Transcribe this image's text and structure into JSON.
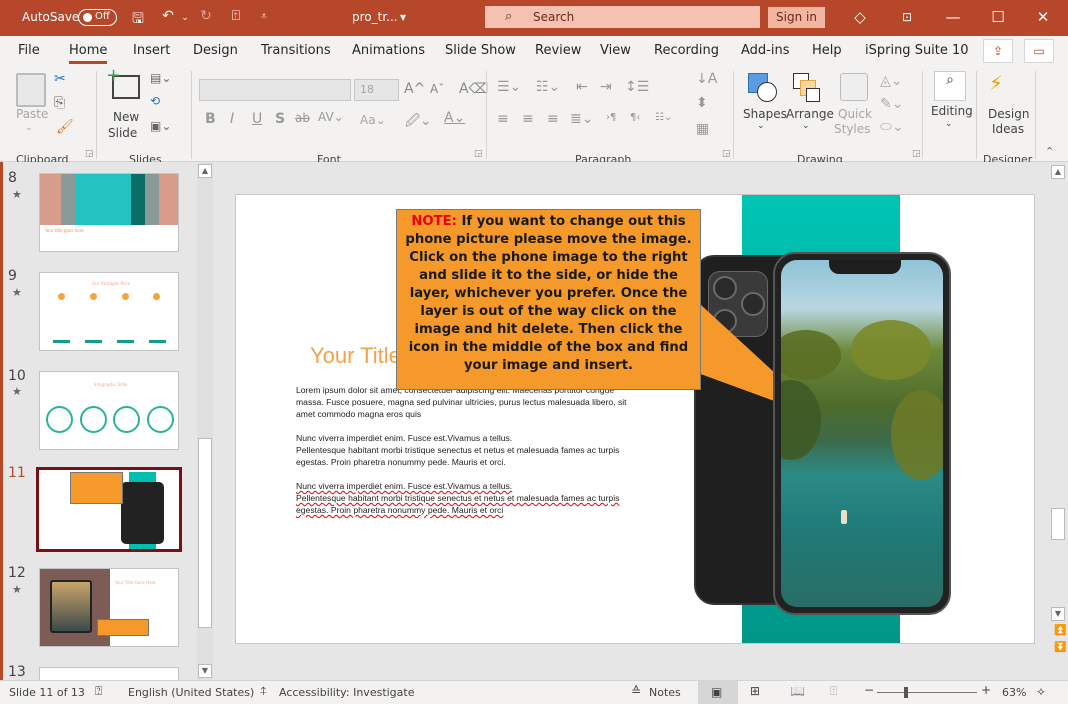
{
  "titlebar": {
    "autosave_label": "AutoSave",
    "autosave_state": "Off",
    "filename": "pro_tr...",
    "search_placeholder": "Search",
    "signin_label": "Sign in",
    "icons": [
      "save-icon",
      "undo-icon",
      "redo-icon",
      "present-icon",
      "customize-icon",
      "diamond-icon",
      "ribbon-display-icon",
      "minimize-icon",
      "maximize-icon",
      "close-icon"
    ]
  },
  "menu": {
    "tabs": [
      "File",
      "Home",
      "Insert",
      "Design",
      "Transitions",
      "Animations",
      "Slide Show",
      "Review",
      "View",
      "Recording",
      "Add-ins",
      "Help",
      "iSpring Suite 10"
    ],
    "active": "Home"
  },
  "ribbon": {
    "clipboard": {
      "group": "Clipboard",
      "paste": "Paste"
    },
    "slides": {
      "group": "Slides",
      "new_slide_1": "New",
      "new_slide_2": "Slide"
    },
    "font": {
      "group": "Font",
      "font_name": "",
      "font_size": "18",
      "case_label": "Aa"
    },
    "paragraph": {
      "group": "Paragraph"
    },
    "drawing": {
      "group": "Drawing",
      "shapes": "Shapes",
      "arrange": "Arrange",
      "quick_styles_1": "Quick",
      "quick_styles_2": "Styles"
    },
    "editing": {
      "label": "Editing"
    },
    "designer": {
      "group": "Designer",
      "design_ideas_1": "Design",
      "design_ideas_2": "Ideas"
    }
  },
  "thumbnails": [
    {
      "number": "8",
      "starred": true,
      "title": "Your title goes here"
    },
    {
      "number": "9",
      "starred": true,
      "title": "Our Packages Price"
    },
    {
      "number": "10",
      "starred": true,
      "title": "Infographic Slide"
    },
    {
      "number": "11",
      "starred": false,
      "selected": true
    },
    {
      "number": "12",
      "starred": true,
      "title": "Your Title Goes Here"
    },
    {
      "number": "13",
      "starred": false
    }
  ],
  "slide": {
    "title": "Your Title",
    "callout_note": "NOTE:",
    "callout_text": " If you want to change out this phone picture please move the image. Click on the phone image to the right and slide it to the side, or hide the layer, whichever you prefer. Once the layer is out of the way click on the image and hit delete. Then click the icon in the middle of the box and find your image and insert.",
    "para1": "Lorem ipsum dolor sit amet, consectetuer adipiscing elit. Maecenas porttitor congue massa. Fusce posuere, magna sed pulvinar ultricies, purus lectus malesuada libero, sit amet commodo magna eros quis",
    "para2_line1": "Nunc viverra imperdiet enim. Fusce est.Vivamus a tellus.",
    "para2_line2": "Pellentesque habitant morbi tristique senectus et netus et malesuada fames ac turpis egestas. Proin pharetra nonummy pede. Mauris et orci.",
    "para3_line1": "Nunc viverra imperdiet enim. Fusce est.Vivamus a tellus.",
    "para3_line2": "Pellentesque habitant morbi tristique senectus et netus et malesuada fames ac turpis egestas. Proin pharetra nonummy pede. Mauris et orci"
  },
  "status": {
    "slide_info": "Slide 11 of 13",
    "language": "English (United States)",
    "accessibility": "Accessibility: Investigate",
    "notes_label": "Notes",
    "zoom": "63%"
  },
  "colors": {
    "accent": "#b7472a",
    "callout": "#f4992a",
    "teal": "#00b3a4",
    "title_orange": "#f4a24a"
  }
}
